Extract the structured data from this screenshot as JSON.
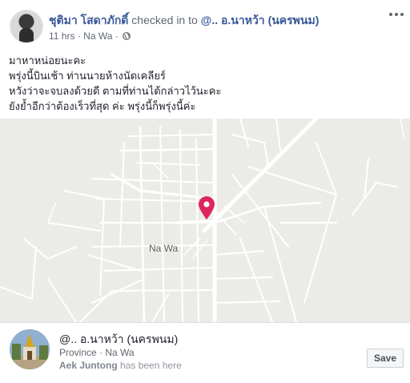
{
  "post": {
    "author": "ชุติมา โสดาภักดิ์",
    "action": "checked in to",
    "place": "@.. อ.นาหว้า (นครพนม)",
    "time": "11 hrs",
    "location": "Na Wa",
    "separator": "·",
    "audience_icon": "globe-icon",
    "more_icon": "more-options-icon",
    "text_lines": [
      "มาหาหน่อยนะคะ",
      "พรุ่งนี้บินเช้า ท่านนายห้างนัดเคลียร์",
      "หวังว่าจะจบลงด้วยดี ตามที่ท่านได้กล่าวไว้นะคะ",
      "ยังย้ำอีกว่าต้องเร็วที่สุด ค่ะ พรุ่งนี้ก็พรุ่งนี้ค่ะ"
    ]
  },
  "map": {
    "town_label": "Na Wa",
    "pin_color": "#e0245e",
    "background_color": "#ebebe8",
    "road_color": "#ffffff"
  },
  "place_card": {
    "name": "@.. อ.นาหว้า (นครพนม)",
    "category": "Province",
    "location": "Na Wa",
    "visitor_name": "Aek Juntong",
    "visitor_text": "has been here",
    "save_label": "Save"
  },
  "colors": {
    "link": "#385898",
    "muted": "#606770"
  }
}
